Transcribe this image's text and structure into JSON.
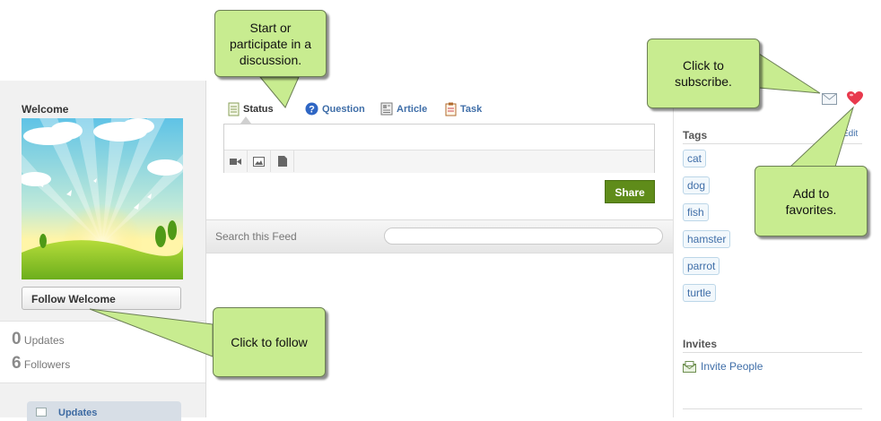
{
  "left": {
    "title": "Welcome",
    "follow_label": "Follow Welcome",
    "stats": [
      {
        "count": "0",
        "label": "Updates"
      },
      {
        "count": "6",
        "label": "Followers"
      }
    ],
    "nav_tab": "Updates"
  },
  "publisher": {
    "tabs": [
      {
        "label": "Status",
        "icon": "document-icon"
      },
      {
        "label": "Question",
        "icon": "question-icon"
      },
      {
        "label": "Article",
        "icon": "article-icon"
      },
      {
        "label": "Task",
        "icon": "task-icon"
      }
    ],
    "share_label": "Share"
  },
  "feed": {
    "search_label": "Search this Feed"
  },
  "right": {
    "tags_heading": "Tags",
    "edit_label": "Edit",
    "tags": [
      "cat",
      "dog",
      "fish",
      "hamster",
      "parrot",
      "turtle"
    ],
    "invites_heading": "Invites",
    "invite_link": "Invite People"
  },
  "callouts": {
    "discussion": "Start or participate in a discussion.",
    "subscribe": "Click to subscribe.",
    "favorites": "Add to favorites.",
    "follow": "Click to follow"
  },
  "colors": {
    "callout_fill": "#c8ec90",
    "share_button": "#5f8c1a",
    "link": "#3f6ea8"
  }
}
